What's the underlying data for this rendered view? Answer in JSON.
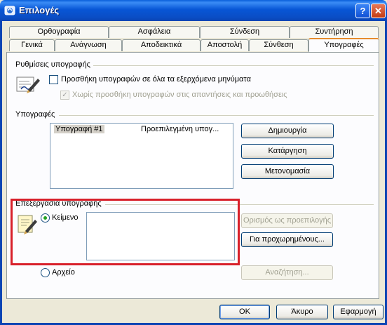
{
  "window": {
    "title": "Επιλογές",
    "help_label": "?",
    "close_label": "✕"
  },
  "tabs_row_back": [
    {
      "label": "Ορθογραφία"
    },
    {
      "label": "Ασφάλεια"
    },
    {
      "label": "Σύνδεση"
    },
    {
      "label": "Συντήρηση"
    }
  ],
  "tabs_row_front": [
    {
      "label": "Γενικά"
    },
    {
      "label": "Ανάγνωση"
    },
    {
      "label": "Αποδεικτικά"
    },
    {
      "label": "Αποστολή"
    },
    {
      "label": "Σύνθεση"
    },
    {
      "label": "Υπογραφές",
      "active": true
    }
  ],
  "settings": {
    "group_label": "Ρυθμίσεις υπογραφής",
    "add_all_label": "Προσθήκη υπογραφών σε όλα τα εξερχόμενα μηνύματα",
    "add_all_checked": false,
    "no_replies_label": "Χωρίς προσθήκη υπογραφών στις απαντήσεις και προωθήσεις",
    "no_replies_checked": true
  },
  "signatures": {
    "group_label": "Υπογραφές",
    "items": [
      {
        "name": "Υπογραφή #1",
        "description": "Προεπιλεγμένη υπογ..."
      }
    ],
    "create_label": "Δημιουργία",
    "remove_label": "Κατάργηση",
    "rename_label": "Μετονομασία"
  },
  "edit": {
    "group_label": "Επεξεργασία υπογραφής",
    "text_option_label": "Κείμενο",
    "text_selected": true,
    "text_value": "",
    "set_default_label": "Ορισμός ως προεπιλογής",
    "advanced_label": "Για προχωρημένους...",
    "file_option_label": "Αρχείο",
    "browse_label": "Αναζήτηση..."
  },
  "footer": {
    "ok_label": "OK",
    "cancel_label": "Άκυρο",
    "apply_label": "Εφαρμογή"
  },
  "colors": {
    "highlight_box": "#d8202a",
    "titlebar": "#0a4ec6",
    "dialog_bg": "#ece9d8"
  }
}
